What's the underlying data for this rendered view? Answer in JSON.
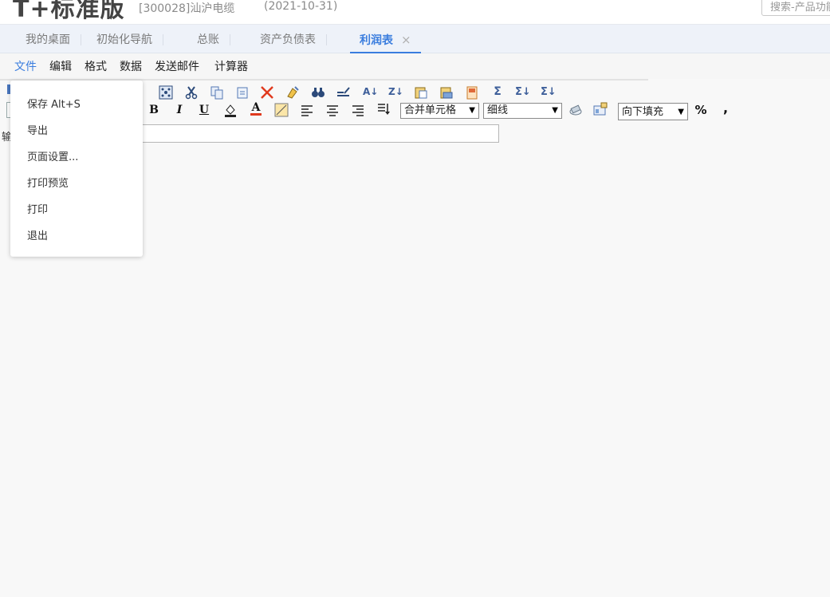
{
  "header": {
    "brand": "T+标准版",
    "company": "[300028]汕沪电缆",
    "period": "(2021-10-31)",
    "search_placeholder": "搜索-产品功能"
  },
  "tabs": [
    {
      "label": "我的桌面"
    },
    {
      "label": "初始化导航"
    },
    {
      "label": "总账"
    },
    {
      "label": "资产负债表"
    },
    {
      "label": "利润表",
      "close": "×"
    }
  ],
  "menubar": [
    "文件",
    "编辑",
    "格式",
    "数据",
    "发送邮件",
    "计算器"
  ],
  "file_menu": [
    "保存 Alt+S",
    "导出",
    "页面设置...",
    "打印预览",
    "打印",
    "退出"
  ],
  "toolbar": {
    "merge_select": "合并单元格",
    "line_select": "细线",
    "fill_select": "向下填充",
    "bold": "B",
    "italic": "I",
    "underline": "U",
    "font_color": "A",
    "percent": "%",
    "comma": ",",
    "sum": "Σ",
    "sum_arrow": "Σ↓",
    "sum_arrow2": "Σ↓",
    "sort_az": "A↓",
    "sort_za": "Z↓",
    "arrow": "▼"
  },
  "formula": {
    "label": "输"
  },
  "colors": {
    "accent": "#3a7dde",
    "delete": "#e03a1e"
  }
}
